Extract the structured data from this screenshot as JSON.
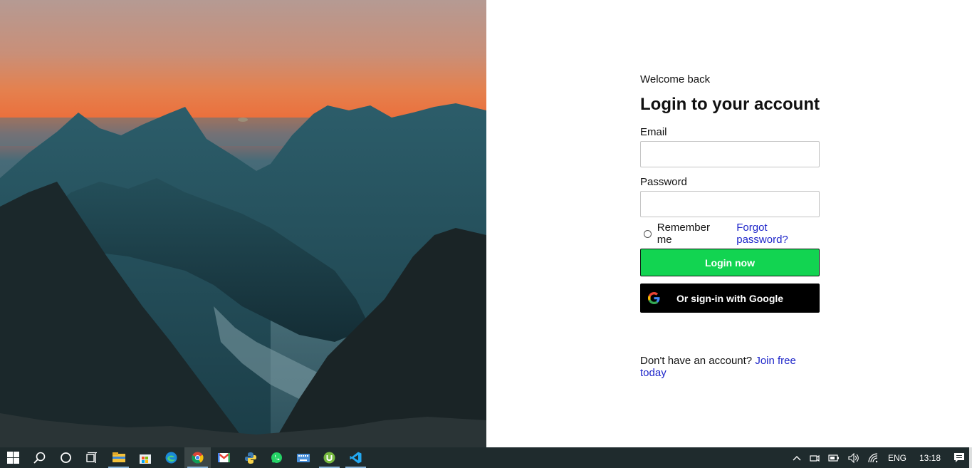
{
  "login": {
    "welcome": "Welcome back",
    "title": "Login to your account",
    "email_label": "Email",
    "email_value": "",
    "password_label": "Password",
    "password_value": "",
    "remember_label": "Remember me",
    "forgot_link": "Forgot password?",
    "login_button": "Login now",
    "google_button": "Or sign-in with Google",
    "signup_prompt": "Don't have an account?",
    "signup_link": "Join free today"
  },
  "colors": {
    "accent_green": "#12d451",
    "link_blue": "#1d25c9",
    "google_button_bg": "#000000",
    "taskbar_bg": "#1f2b2d"
  },
  "taskbar": {
    "apps": [
      {
        "icon": "windows-start-icon"
      },
      {
        "icon": "search-icon"
      },
      {
        "icon": "cortana-icon"
      },
      {
        "icon": "task-view-icon"
      },
      {
        "icon": "file-explorer-icon"
      },
      {
        "icon": "microsoft-store-icon"
      },
      {
        "icon": "edge-icon"
      },
      {
        "icon": "chrome-icon"
      },
      {
        "icon": "gmail-icon"
      },
      {
        "icon": "python-icon"
      },
      {
        "icon": "whatsapp-icon"
      },
      {
        "icon": "keyboard-icon"
      },
      {
        "icon": "utorrent-icon"
      },
      {
        "icon": "vscode-icon"
      }
    ],
    "tray": {
      "language": "ENG",
      "time": "13:18"
    }
  }
}
